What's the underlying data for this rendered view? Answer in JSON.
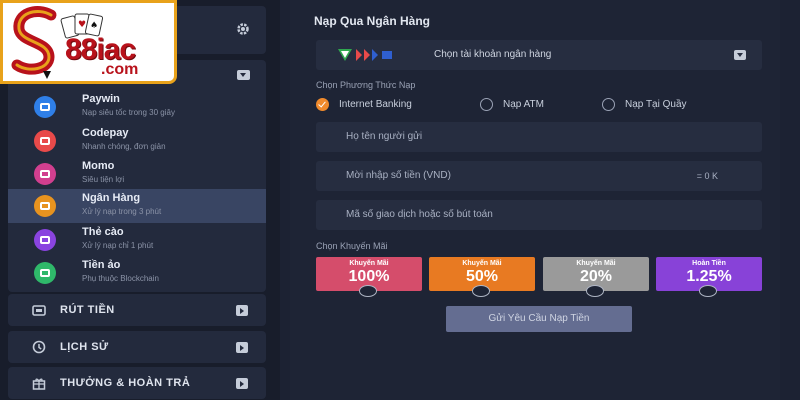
{
  "logo": {
    "brand": "88iac",
    "domain": ".com",
    "icon": "dragon-s-logo"
  },
  "sidebar": {
    "top_icon": "gear-icon",
    "deposit_chevron": "chevron-down-icon",
    "methods": [
      {
        "title": "Paywin",
        "subtitle": "Nạp siêu tốc trong 30 giây",
        "icon": "paywin-icon",
        "color": "#2f7fe8",
        "active": false
      },
      {
        "title": "Codepay",
        "subtitle": "Nhanh chóng, đơn giản",
        "icon": "codepay-icon",
        "color": "#e84a4a",
        "active": false
      },
      {
        "title": "Momo",
        "subtitle": "Siêu tiện lợi",
        "icon": "momo-icon",
        "color": "#d13f8f",
        "active": false
      },
      {
        "title": "Ngân Hàng",
        "subtitle": "Xử lý nạp trong 3 phút",
        "icon": "bank-icon",
        "color": "#e8931f",
        "active": true
      },
      {
        "title": "Thẻ cào",
        "subtitle": "Xử lý nạp chỉ 1 phút",
        "icon": "card-icon",
        "color": "#8a44e0",
        "active": false
      },
      {
        "title": "Tiền ảo",
        "subtitle": "Phụ thuộc Blockchain",
        "icon": "crypto-icon",
        "color": "#2fb86a",
        "active": false
      }
    ],
    "nav": [
      {
        "label": "RÚT TIỀN",
        "icon": "wallet-icon"
      },
      {
        "label": "LỊCH SỬ",
        "icon": "history-icon"
      },
      {
        "label": "THƯỞNG & HOÀN TRẢ",
        "icon": "gift-icon"
      }
    ]
  },
  "main": {
    "title": "Nạp Qua Ngân Hàng",
    "bank_select": {
      "placeholder": "Chọn tài khoản ngân hàng"
    },
    "method_label": "Chọn Phương Thức Nạp",
    "methods": [
      {
        "label": "Internet Banking",
        "selected": true
      },
      {
        "label": "Nạp ATM",
        "selected": false
      },
      {
        "label": "Nạp Tại Quầy",
        "selected": false
      }
    ],
    "fields": {
      "sender": "Họ tên người gửi",
      "amount": "Mời nhập số tiền (VND)",
      "amount_suffix": "= 0 K",
      "txn": "Mã số giao dịch hoặc số bút toán"
    },
    "promo_label": "Chọn Khuyến Mãi",
    "promos": [
      {
        "label": "Khuyến Mãi",
        "value": "100%",
        "color": "#d54d6b"
      },
      {
        "label": "Khuyến Mãi",
        "value": "50%",
        "color": "#e87a22"
      },
      {
        "label": "Khuyến Mãi",
        "value": "20%",
        "color": "#9a9a9a"
      },
      {
        "label": "Hoàn Tiền",
        "value": "1.25%",
        "color": "#8842d8"
      }
    ],
    "submit_label": "Gửi Yêu Cầu Nạp Tiền"
  }
}
